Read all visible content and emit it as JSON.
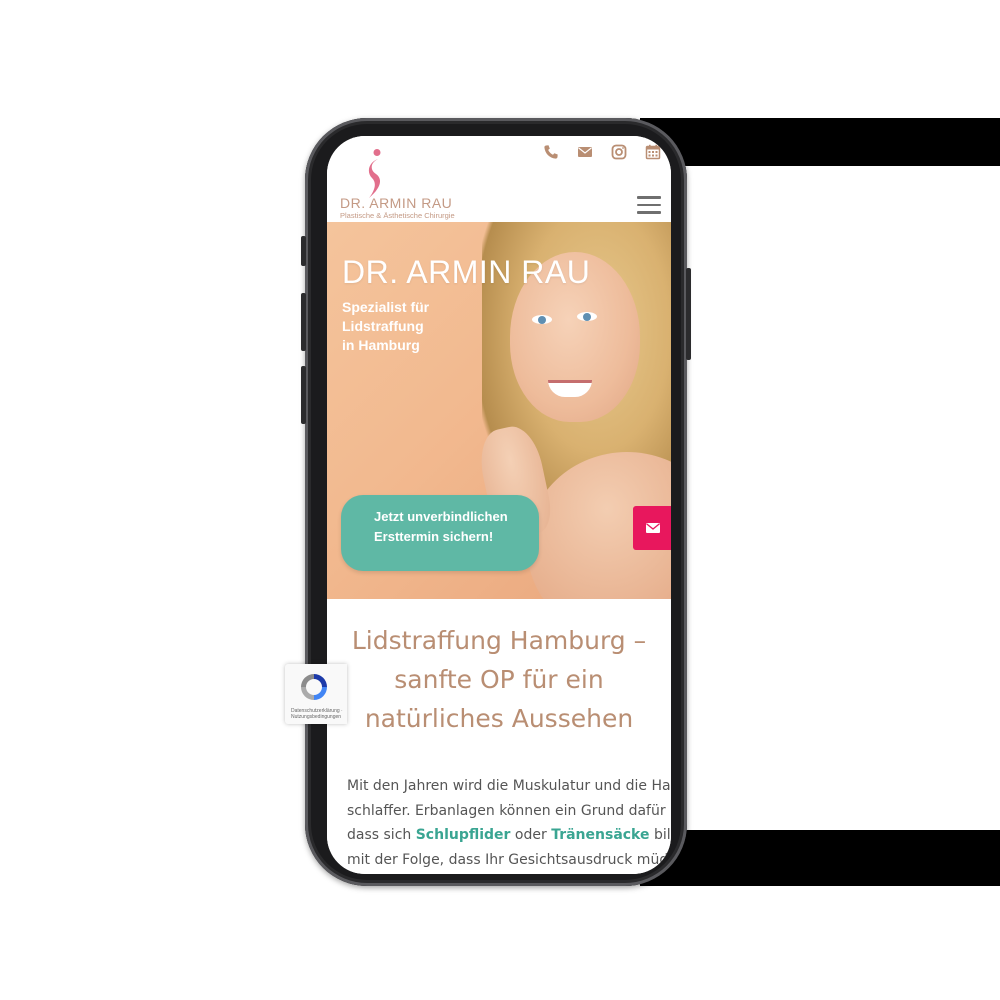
{
  "header": {
    "logo_name": "DR. ARMIN RAU",
    "logo_subtitle": "Plastische & Ästhetische Chirurgie",
    "icons": [
      "phone-icon",
      "envelope-icon",
      "instagram-icon",
      "calendar-icon"
    ],
    "accent_color": "#b98e73"
  },
  "hero": {
    "title": "DR. ARMIN RAU",
    "subtitle_line1": "Spezialist für Lidstraffung",
    "subtitle_line2": "in Hamburg",
    "cta_line1": "Jetzt unverbindlichen",
    "cta_line2": "Ersttermin sichern!",
    "cta_color": "#5fb8a5",
    "mail_tab_color": "#e8175d"
  },
  "content": {
    "heading_line1": "Lidstraffung Hamburg –",
    "heading_line2": "sanfte OP für ein",
    "heading_line3": "natürliches Aussehen",
    "p_line1": "Mit den Jahren wird die Muskulatur und die Haut",
    "p_line2": "schlaffer. Erbanlagen können ein Grund dafür",
    "p_line3_a": "dass sich ",
    "p_line3_link1": "Schlupflider",
    "p_line3_b": " oder ",
    "p_line3_link2": "Tränensäcke",
    "p_line3_c": " bilden,",
    "p_line4": "mit der Folge, dass Ihr Gesichtsausdruck müde"
  },
  "recaptcha": {
    "text": "Datenschutzerklärung · Nutzungsbedingungen"
  }
}
